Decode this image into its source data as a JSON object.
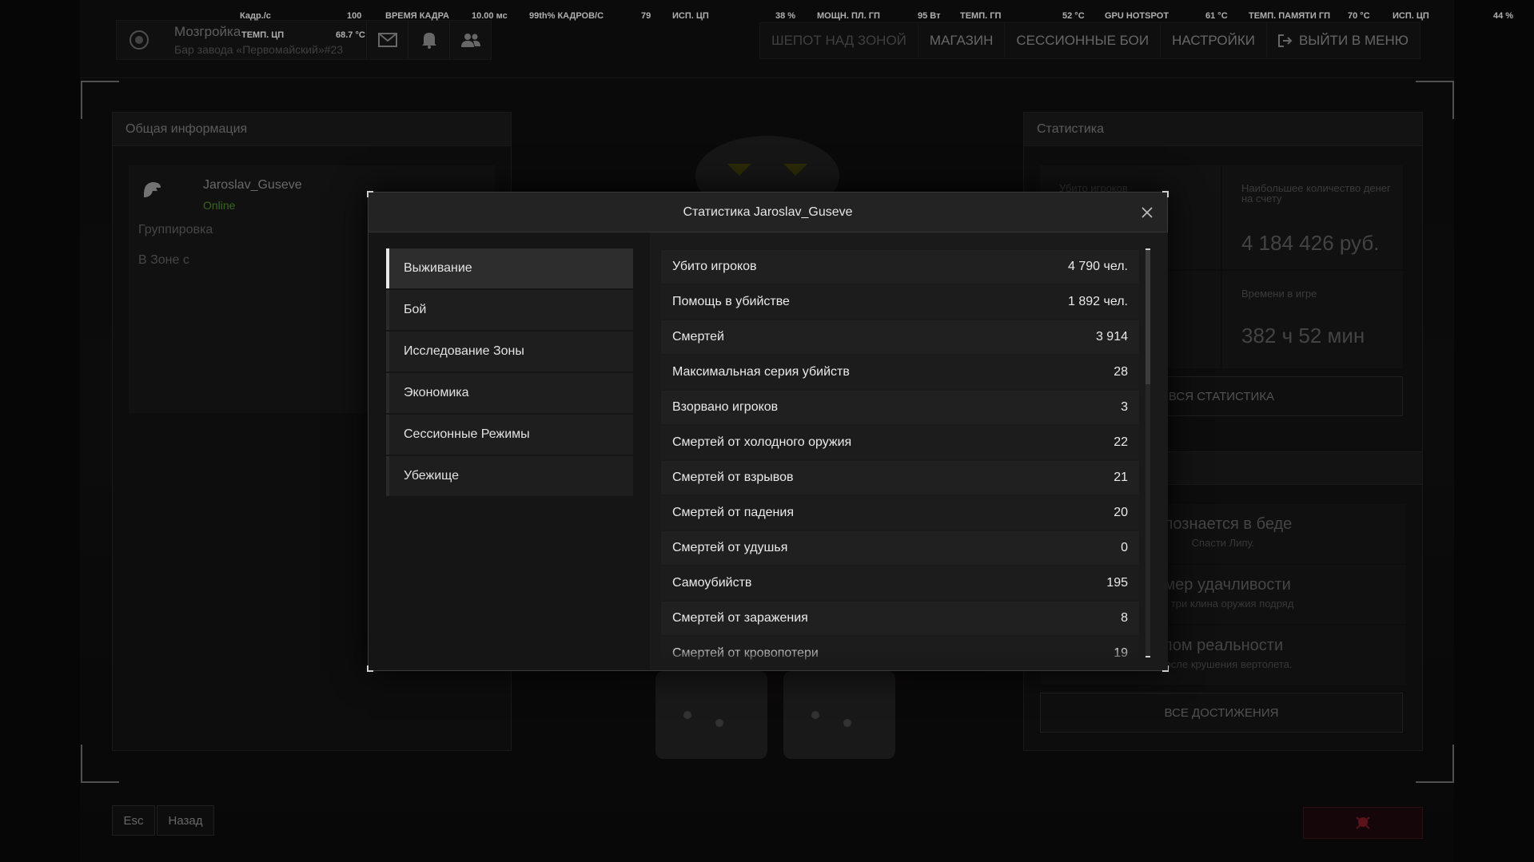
{
  "perf_overlay": {
    "fps_label": "Кадр./с",
    "fps_value": "100",
    "frametime_label": "ВРЕМЯ КАДРА",
    "frametime_value": "10.00 мс",
    "p99_label": "99th% КАДРОВ/С",
    "p99_value": "79",
    "cpu_usage_label": "ИСП. ЦП",
    "cpu_usage_value": "38 %",
    "gpu_power_label": "МОЩН. ПЛ. ГП",
    "gpu_power_value": "95 Вт",
    "gpu_temp_label": "ТЕМП. ГП",
    "gpu_temp_value": "52 °C",
    "gpu_hotspot_label": "GPU HOTSPOT",
    "gpu_hotspot_value": "61 °C",
    "gpu_mem_temp_label": "ТЕМП. ПАМЯТИ ГП",
    "gpu_mem_temp_value": "70 °C",
    "gpu_usage_label": "ИСП. ЦП",
    "gpu_usage_value": "44 %",
    "cpu_temp_label": "ТЕМП. ЦП",
    "cpu_temp_value": "68.7 °C"
  },
  "header": {
    "brand_name": "Мозгройка",
    "brand_sub": "Бар завода «Первомайский»#23",
    "nav": [
      "ШЕПОТ НАД ЗОНОЙ",
      "МАГАЗИН",
      "СЕССИОННЫЕ БОИ",
      "НАСТРОЙКИ",
      "ВЫЙТИ В МЕНЮ"
    ]
  },
  "left_panel": {
    "title": "Общая информация",
    "username": "Jaroslav_Guseve",
    "status": "Online",
    "group_label": "Группировка",
    "zone_label": "В Зоне с"
  },
  "right_panel": {
    "title": "Статистика",
    "kills_label": "Убито игроков",
    "max_money_label": "Наибольшее количество денег на счету",
    "max_money_value": "4 184 426 руб.",
    "time_label": "Времени в игре",
    "time_value": "382 ч 52 мин",
    "all_stats_button": "ВСЯ СТАТИСТИКА",
    "achievements": [
      {
        "title": "г познается в беде",
        "desc": "Спасти Липу."
      },
      {
        "title": "имер удачливости",
        "desc": "ать три клина оружия подряд"
      },
      {
        "title": "лом реальности",
        "desc": ". после крушения вертолета."
      }
    ],
    "all_achievements_button": "ВСЕ ДОСТИЖЕНИЯ"
  },
  "bottom": {
    "esc_label": "Esc",
    "back_label": "Назад"
  },
  "modal": {
    "title": "Статистика Jaroslav_Guseve",
    "categories": [
      "Выживание",
      "Бой",
      "Исследование Зоны",
      "Экономика",
      "Сессионные Режимы",
      "Убежище"
    ],
    "active_category": "Выживание",
    "rows": [
      {
        "label": "Убито игроков",
        "value": "4 790 чел."
      },
      {
        "label": "Помощь в убийстве",
        "value": "1 892 чел."
      },
      {
        "label": "Смертей",
        "value": "3 914"
      },
      {
        "label": "Максимальная серия убийств",
        "value": "28"
      },
      {
        "label": "Взорвано игроков",
        "value": "3"
      },
      {
        "label": "Смертей от холодного оружия",
        "value": "22"
      },
      {
        "label": "Смертей от взрывов",
        "value": "21"
      },
      {
        "label": "Смертей от падения",
        "value": "20"
      },
      {
        "label": "Смертей от удушья",
        "value": "0"
      },
      {
        "label": "Самоубийств",
        "value": "195"
      },
      {
        "label": "Смертей от заражения",
        "value": "8"
      },
      {
        "label": "Смертей от кровопотери",
        "value": "19"
      }
    ]
  }
}
